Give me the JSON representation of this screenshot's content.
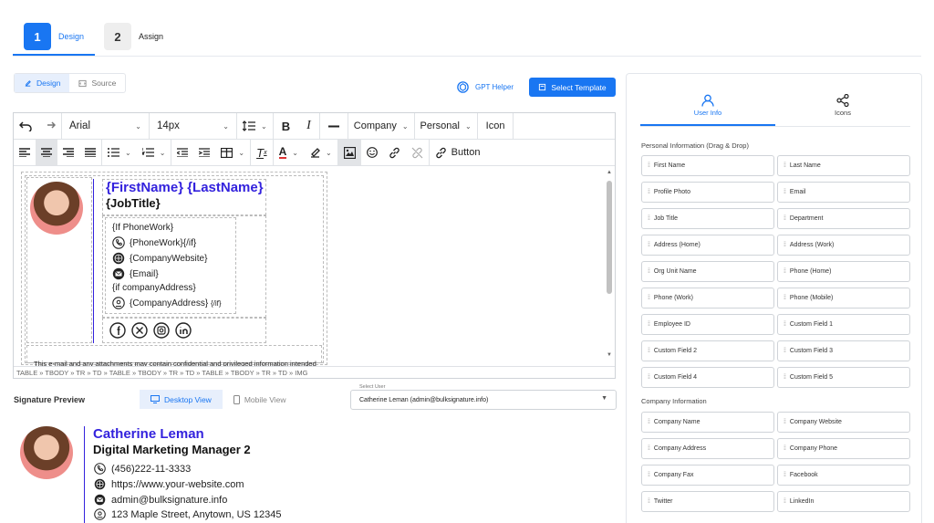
{
  "stepper": {
    "steps": [
      {
        "num": "1",
        "label": "Design"
      },
      {
        "num": "2",
        "label": "Assign"
      }
    ]
  },
  "mode": {
    "design": "Design",
    "source": "Source"
  },
  "actions": {
    "gpt_helper": "GPT Helper",
    "select_template": "Select Template"
  },
  "toolbar": {
    "font": "Arial",
    "size": "14px",
    "company": "Company",
    "personal": "Personal",
    "icon": "Icon",
    "button": "Button"
  },
  "editor": {
    "name": "{FirstName} {LastName}",
    "job_title": "{JobTitle}",
    "if_phone": "{If PhoneWork}",
    "phone": "{PhoneWork}{/if}",
    "website": "{CompanyWebsite}",
    "email": "{Email}",
    "if_address": "{if companyAddress}",
    "address": "{CompanyAddress}",
    "address_end": "{/if}",
    "disclaimer": "This e-mail and any attachments may contain confidential and privileged information intended",
    "status_path": "TABLE » TBODY » TR » TD » TABLE » TBODY » TR » TD » TABLE » TBODY » TR » TD » IMG"
  },
  "preview": {
    "label": "Signature Preview",
    "desktop_view": "Desktop View",
    "mobile_view": "Mobile View",
    "select_user_label": "Select User",
    "selected_user": "Catherine Leman (admin@bulksignature.info)",
    "name": "Catherine Leman",
    "title": "Digital Marketing Manager 2",
    "phone": "(456)222-11-3333",
    "website": "https://www.your-website.com",
    "email": "admin@bulksignature.info",
    "address": "123 Maple Street, Anytown, US 12345"
  },
  "right_panel": {
    "tabs": [
      {
        "label": "User Info"
      },
      {
        "label": "Icons"
      }
    ],
    "personal_title": "Personal Information (Drag & Drop)",
    "personal_fields": [
      "First Name",
      "Last Name",
      "Profile Photo",
      "Email",
      "Job Title",
      "Department",
      "Address (Home)",
      "Address (Work)",
      "Org Unit Name",
      "Phone (Home)",
      "Phone (Work)",
      "Phone (Mobile)",
      "Employee ID",
      "Custom Field 1",
      "Custom Field 2",
      "Custom Field 3",
      "Custom Field 4",
      "Custom Field 5"
    ],
    "company_title": "Company Information",
    "company_fields": [
      "Company Name",
      "Company Website",
      "Company Address",
      "Company Phone",
      "Company Fax",
      "Facebook",
      "Twitter",
      "LinkedIn"
    ]
  },
  "colors": {
    "accent": "#1976f2",
    "signature_name": "#3322dd"
  }
}
